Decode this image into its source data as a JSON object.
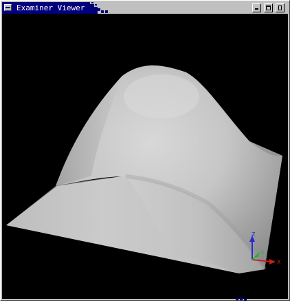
{
  "window": {
    "title": "Examiner Viewer",
    "buttons": {
      "minimize_label": "minimize",
      "maximize_label": "maximize",
      "close_label": "close"
    },
    "colors": {
      "title_active": "#00007b",
      "frame": "#c0c0c0",
      "viewport_bg": "#000000"
    }
  },
  "viewer": {
    "scene": "shaded gray surface mesh (hill)",
    "axes": {
      "x_label": "X",
      "y_label": "Y",
      "z_label": "Z",
      "x_color": "#c81e1e",
      "y_color": "#1eb41e",
      "z_color": "#2828d2"
    }
  }
}
